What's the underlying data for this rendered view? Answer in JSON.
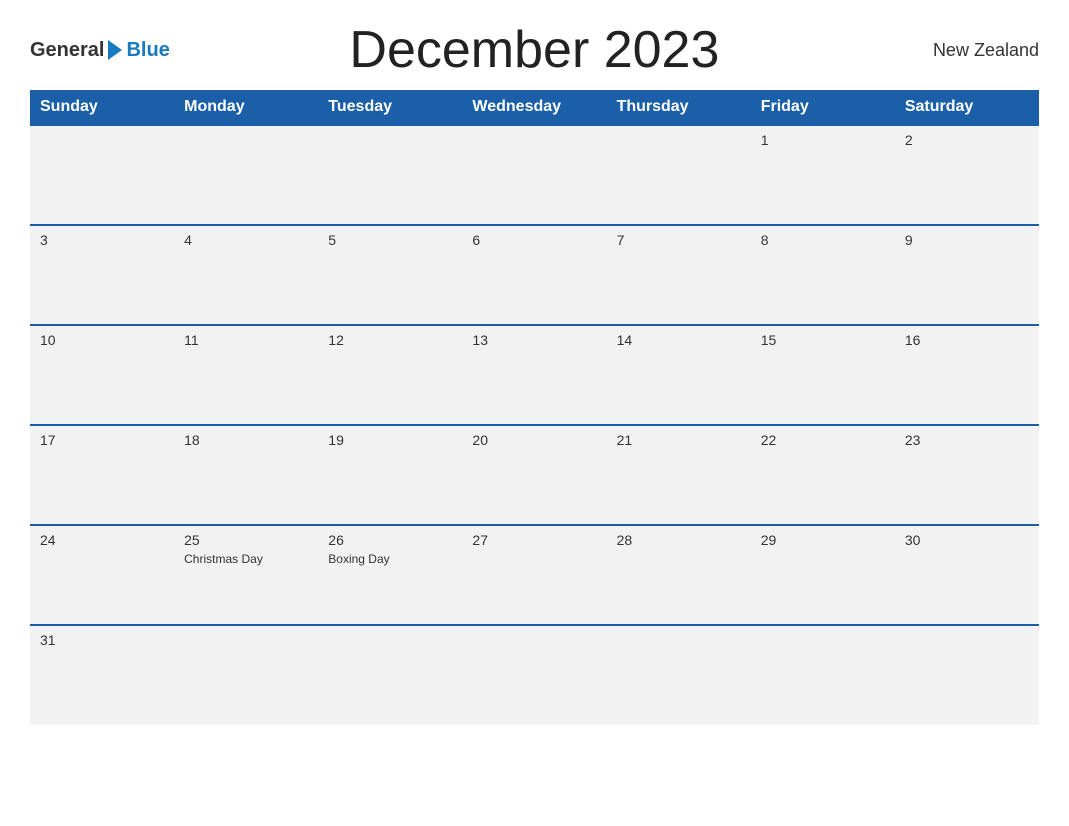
{
  "header": {
    "logo": {
      "general": "General",
      "blue": "Blue"
    },
    "title": "December 2023",
    "country": "New Zealand"
  },
  "calendar": {
    "weekdays": [
      "Sunday",
      "Monday",
      "Tuesday",
      "Wednesday",
      "Thursday",
      "Friday",
      "Saturday"
    ],
    "weeks": [
      [
        {
          "day": "",
          "holiday": ""
        },
        {
          "day": "",
          "holiday": ""
        },
        {
          "day": "",
          "holiday": ""
        },
        {
          "day": "",
          "holiday": ""
        },
        {
          "day": "",
          "holiday": ""
        },
        {
          "day": "1",
          "holiday": ""
        },
        {
          "day": "2",
          "holiday": ""
        }
      ],
      [
        {
          "day": "3",
          "holiday": ""
        },
        {
          "day": "4",
          "holiday": ""
        },
        {
          "day": "5",
          "holiday": ""
        },
        {
          "day": "6",
          "holiday": ""
        },
        {
          "day": "7",
          "holiday": ""
        },
        {
          "day": "8",
          "holiday": ""
        },
        {
          "day": "9",
          "holiday": ""
        }
      ],
      [
        {
          "day": "10",
          "holiday": ""
        },
        {
          "day": "11",
          "holiday": ""
        },
        {
          "day": "12",
          "holiday": ""
        },
        {
          "day": "13",
          "holiday": ""
        },
        {
          "day": "14",
          "holiday": ""
        },
        {
          "day": "15",
          "holiday": ""
        },
        {
          "day": "16",
          "holiday": ""
        }
      ],
      [
        {
          "day": "17",
          "holiday": ""
        },
        {
          "day": "18",
          "holiday": ""
        },
        {
          "day": "19",
          "holiday": ""
        },
        {
          "day": "20",
          "holiday": ""
        },
        {
          "day": "21",
          "holiday": ""
        },
        {
          "day": "22",
          "holiday": ""
        },
        {
          "day": "23",
          "holiday": ""
        }
      ],
      [
        {
          "day": "24",
          "holiday": ""
        },
        {
          "day": "25",
          "holiday": "Christmas Day"
        },
        {
          "day": "26",
          "holiday": "Boxing Day"
        },
        {
          "day": "27",
          "holiday": ""
        },
        {
          "day": "28",
          "holiday": ""
        },
        {
          "day": "29",
          "holiday": ""
        },
        {
          "day": "30",
          "holiday": ""
        }
      ],
      [
        {
          "day": "31",
          "holiday": ""
        },
        {
          "day": "",
          "holiday": ""
        },
        {
          "day": "",
          "holiday": ""
        },
        {
          "day": "",
          "holiday": ""
        },
        {
          "day": "",
          "holiday": ""
        },
        {
          "day": "",
          "holiday": ""
        },
        {
          "day": "",
          "holiday": ""
        }
      ]
    ]
  }
}
